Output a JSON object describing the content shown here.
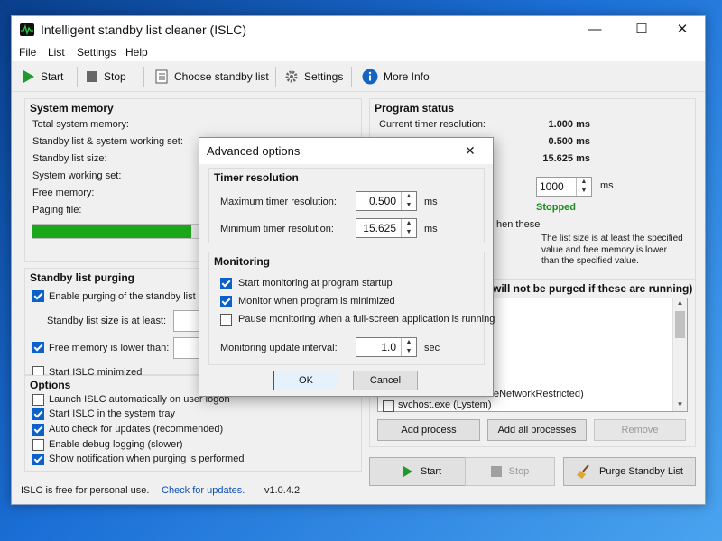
{
  "window": {
    "title": "Intelligent standby list cleaner (ISLC)",
    "minimize_glyph": "—",
    "maximize_glyph": "☐",
    "close_glyph": "✕"
  },
  "menu": {
    "items": [
      "File",
      "List",
      "Settings",
      "Help"
    ]
  },
  "toolbar": {
    "start": "Start",
    "stop": "Stop",
    "choose": "Choose standby list",
    "settings": "Settings",
    "more_info": "More Info"
  },
  "system_memory": {
    "title": "System memory",
    "rows": [
      "Total system memory:",
      "Standby list & system working set:",
      "Standby list size:",
      "System working set:",
      "Free memory:",
      "Paging file:"
    ],
    "progress_fraction": 0.88
  },
  "purging": {
    "title": "Standby list purging",
    "enable_label": "Enable purging of the standby list",
    "size_label": "Standby list size is at least:",
    "free_label": "Free memory is lower than:",
    "minimized_label": "Start ISLC minimized"
  },
  "options": {
    "title": "Options",
    "items": [
      {
        "label": "Launch ISLC automatically on user logon",
        "checked": false
      },
      {
        "label": "Start ISLC in the system tray",
        "checked": true
      },
      {
        "label": "Auto check for updates (recommended)",
        "checked": true
      },
      {
        "label": "Enable debug logging (slower)",
        "checked": false
      },
      {
        "label": "Show notification when purging is performed",
        "checked": true
      }
    ]
  },
  "footer": {
    "free_text": "ISLC is free for personal use.",
    "update_link": "Check for updates.",
    "version": "v1.0.4.2"
  },
  "program_status": {
    "title": "Program status",
    "current_label": "Current timer resolution:",
    "current_value": "1.000 ms",
    "value2": "0.500 ms",
    "value3": "15.625 ms",
    "polling_value": "1000",
    "polling_unit": "ms",
    "status": "Stopped",
    "when_these": "hen these",
    "note": "The list size is at least the specified value and free memory is lower than the specified value.",
    "status_color": "#1a8a1a"
  },
  "exclusions": {
    "title": "will not be purged if these are running)",
    "partial_item": "eNetworkRestricted)",
    "item_last": "svchost.exe (Lystem)",
    "add_process": "Add process",
    "add_all": "Add all processes",
    "remove": "Remove"
  },
  "bottom_buttons": {
    "start": "Start",
    "stop": "Stop",
    "purge": "Purge Standby List"
  },
  "dialog": {
    "title": "Advanced options",
    "close_glyph": "✕",
    "timer_group": "Timer resolution",
    "max_label": "Maximum timer resolution:",
    "max_value": "0.500",
    "min_label": "Minimum timer resolution:",
    "min_value": "15.625",
    "unit_ms": "ms",
    "monitoring_group": "Monitoring",
    "mon_items": [
      {
        "label": "Start monitoring at program startup",
        "checked": true
      },
      {
        "label": "Monitor when program is minimized",
        "checked": true
      },
      {
        "label": "Pause monitoring when a full-screen application is running",
        "checked": false
      }
    ],
    "interval_label": "Monitoring update interval:",
    "interval_value": "1.0",
    "interval_unit": "sec",
    "ok": "OK",
    "cancel": "Cancel"
  },
  "colors": {
    "accent": "#0b61c9",
    "progress": "#1aa81a",
    "link": "#0b4fb8"
  }
}
